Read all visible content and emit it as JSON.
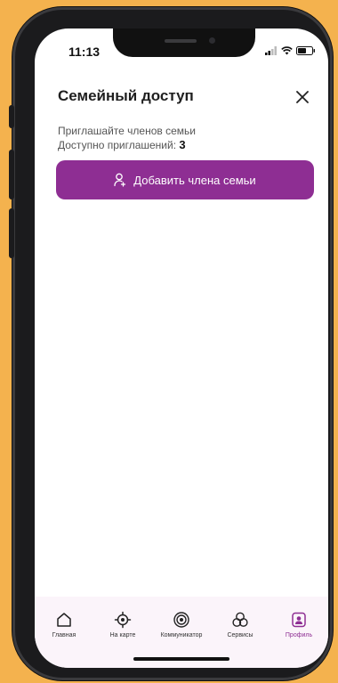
{
  "status_bar": {
    "time": "11:13"
  },
  "modal": {
    "title": "Семейный доступ",
    "invite_text": "Приглашайте членов семьи",
    "available_label": "Доступно приглашений:",
    "available_count": "3",
    "add_button_label": "Добавить члена семьи"
  },
  "tabbar": {
    "items": [
      {
        "label": "Главная",
        "icon": "home-icon"
      },
      {
        "label": "На карте",
        "icon": "map-target-icon"
      },
      {
        "label": "Коммуникатор",
        "icon": "communicator-icon"
      },
      {
        "label": "Сервисы",
        "icon": "services-icon"
      },
      {
        "label": "Профиль",
        "icon": "profile-icon",
        "active": true
      }
    ]
  },
  "colors": {
    "accent": "#8E2E93",
    "background": "#F4B24E",
    "tabbar": "#FBF4FA"
  }
}
